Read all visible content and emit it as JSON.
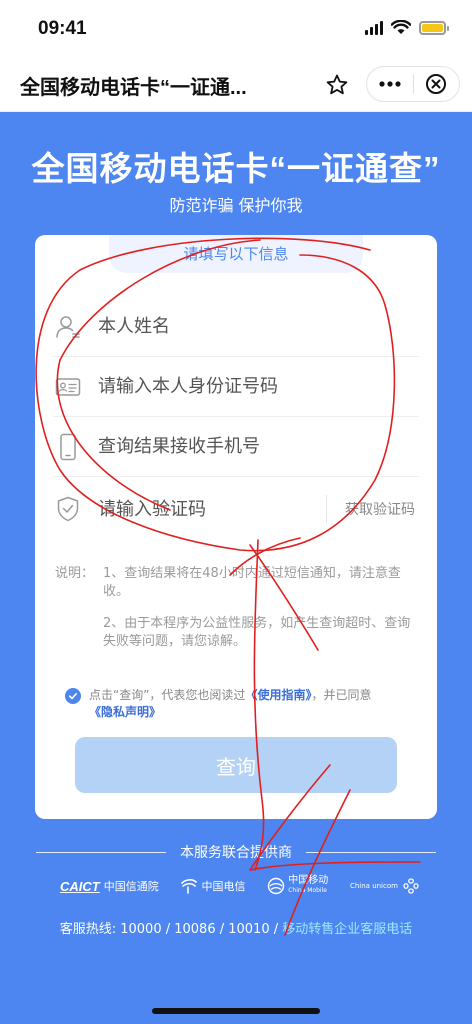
{
  "status_bar": {
    "time": "09:41"
  },
  "title_bar": {
    "title": "全国移动电话卡“一证通..."
  },
  "hero": {
    "title": "全国移动电话卡“一证通查”",
    "subtitle": "防范诈骗 保护你我"
  },
  "form": {
    "tab_label": "请填写以下信息",
    "name_placeholder": "本人姓名",
    "id_placeholder": "请输入本人身份证号码",
    "phone_placeholder": "查询结果接收手机号",
    "code_placeholder": "请输入验证码",
    "get_code_label": "获取验证码"
  },
  "notes": {
    "label": "说明：",
    "item1": "1、查询结果将在48小时内通过短信通知，请注意查收。",
    "item2": "2、由于本程序为公益性服务，如产生查询超时、查询失败等问题，请您谅解。"
  },
  "agreement": {
    "prefix": "点击“查询”，代表您也阅读过",
    "guide_link": "《使用指南》",
    "middle": "，并已同意",
    "privacy_link": "《隐私声明》",
    "checked": true
  },
  "query_button_label": "查询",
  "footer": {
    "providers_heading": "本服务联合提供商",
    "logos": {
      "caict_mark": "CAICT",
      "caict_name": "中国信通院",
      "telecom_name": "中国电信",
      "mobile_name": "中国移动",
      "mobile_en": "China Mobile",
      "unicom_name": "China unicom"
    },
    "hotline_text": "客服热线: 10000 / 10086 / 10010 / ",
    "hotline_link": "移动转售企业客服电话"
  },
  "colors": {
    "brand_blue": "#4d86f0",
    "button_disabled": "#b4d2f6",
    "annotation_red": "#e02020"
  }
}
